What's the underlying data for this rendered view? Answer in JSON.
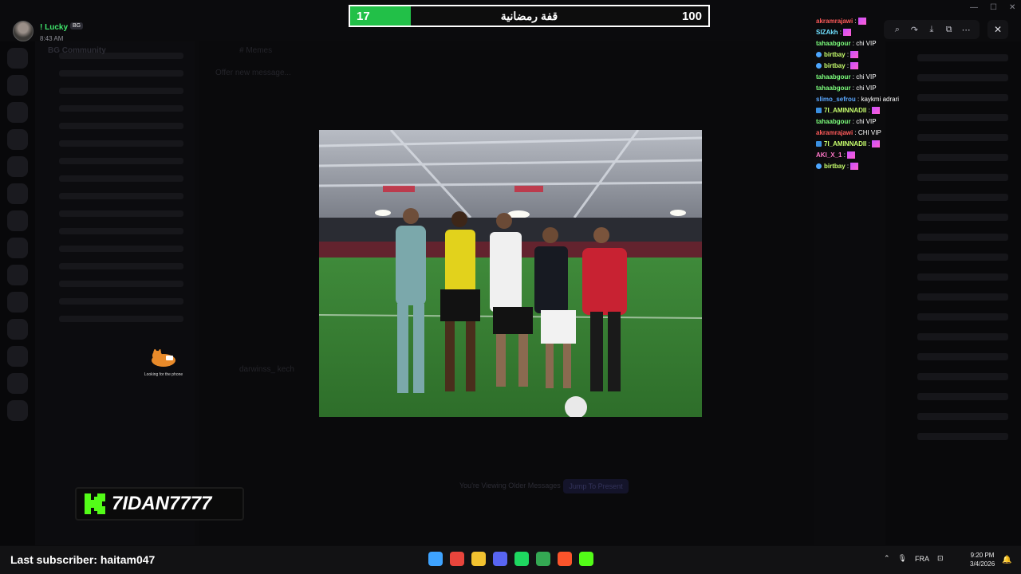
{
  "user": {
    "name": "! Lucky",
    "tag": "BG",
    "time": "8:43 AM"
  },
  "background": {
    "server_header": "BG Community",
    "channel_header": "# Memes",
    "banner_text": "Offer new message...",
    "bottom_hint": "You're Viewing Older Messages",
    "bottom_hint_button": "Jump To Present",
    "bg_user": "darwinss_ kech"
  },
  "goal": {
    "current": "17",
    "title": "قفة رمضانية",
    "target": "100",
    "progress": 0.17,
    "fill_color": "#22c048"
  },
  "viewer": {
    "tools": [
      {
        "icon": "zoom-icon",
        "glyph": "⌕"
      },
      {
        "icon": "forward-icon",
        "glyph": "↷"
      },
      {
        "icon": "download-icon",
        "glyph": "⤓"
      },
      {
        "icon": "open-external-icon",
        "glyph": "⧉"
      },
      {
        "icon": "more-icon",
        "glyph": "⋯"
      }
    ],
    "close_glyph": "✕"
  },
  "window_controls": {
    "minimize": "—",
    "maximize": "☐",
    "close": "✕"
  },
  "stream_chat": [
    {
      "user": "akramrajawi",
      "msg": ":",
      "color": "#ff5a5a",
      "badge": "",
      "emote": true
    },
    {
      "user": "SIZAkh",
      "msg": ":",
      "color": "#6fe0ff",
      "badge": "",
      "emote": true
    },
    {
      "user": "tahaabgour",
      "msg": ": chi VIP",
      "color": "#7dff7d",
      "badge": "",
      "emote": false
    },
    {
      "user": "birtbay",
      "msg": ":",
      "color": "#c8ff6e",
      "badge": "dot",
      "emote": true
    },
    {
      "user": "birtbay",
      "msg": ":",
      "color": "#c8ff6e",
      "badge": "dot",
      "emote": true
    },
    {
      "user": "tahaabgour",
      "msg": ": chi VIP",
      "color": "#7dff7d",
      "badge": "",
      "emote": false
    },
    {
      "user": "tahaabgour",
      "msg": ": chi VIP",
      "color": "#7dff7d",
      "badge": "",
      "emote": false
    },
    {
      "user": "slimo_sefrou",
      "msg": ": kaykmi adrari",
      "color": "#5aa7ff",
      "badge": "",
      "emote": false
    },
    {
      "user": "7I_AMINNADII",
      "msg": ":",
      "color": "#c8ff6e",
      "badge": "sq",
      "emote": true
    },
    {
      "user": "tahaabgour",
      "msg": ": chi VIP",
      "color": "#7dff7d",
      "badge": "",
      "emote": false
    },
    {
      "user": "akramrajawi",
      "msg": ": CHI VIP",
      "color": "#ff5a5a",
      "badge": "",
      "emote": false
    },
    {
      "user": "7I_AMINNADII",
      "msg": ":",
      "color": "#c8ff6e",
      "badge": "sq",
      "emote": true
    },
    {
      "user": "AKI_X_1",
      "msg": ":",
      "color": "#ff77c8",
      "badge": "",
      "emote": true
    },
    {
      "user": "birtbay",
      "msg": ":",
      "color": "#c8ff6e",
      "badge": "dot",
      "emote": true
    }
  ],
  "sticker": {
    "caption": "Looking for the phone"
  },
  "kick": {
    "name": "7IDAN7777",
    "brand_color": "#53fc18"
  },
  "footer": {
    "last_subscriber": "Last subscriber: haitam047"
  },
  "taskbar": {
    "apps": [
      {
        "name": "windows-start-icon",
        "color": "#3ea3ff"
      },
      {
        "name": "chrome-icon",
        "color": "#e8453c"
      },
      {
        "name": "file-explorer-icon",
        "color": "#f2c230"
      },
      {
        "name": "discord-icon",
        "color": "#5865f2"
      },
      {
        "name": "spotify-icon",
        "color": "#1ed760"
      },
      {
        "name": "chrome-profile-icon",
        "color": "#34a853"
      },
      {
        "name": "brave-icon",
        "color": "#fb542b"
      },
      {
        "name": "kick-app-icon",
        "color": "#53fc18"
      }
    ],
    "tray_lang": "FRA",
    "clock_time": "9:20 PM",
    "clock_date": "3/4/2026"
  }
}
